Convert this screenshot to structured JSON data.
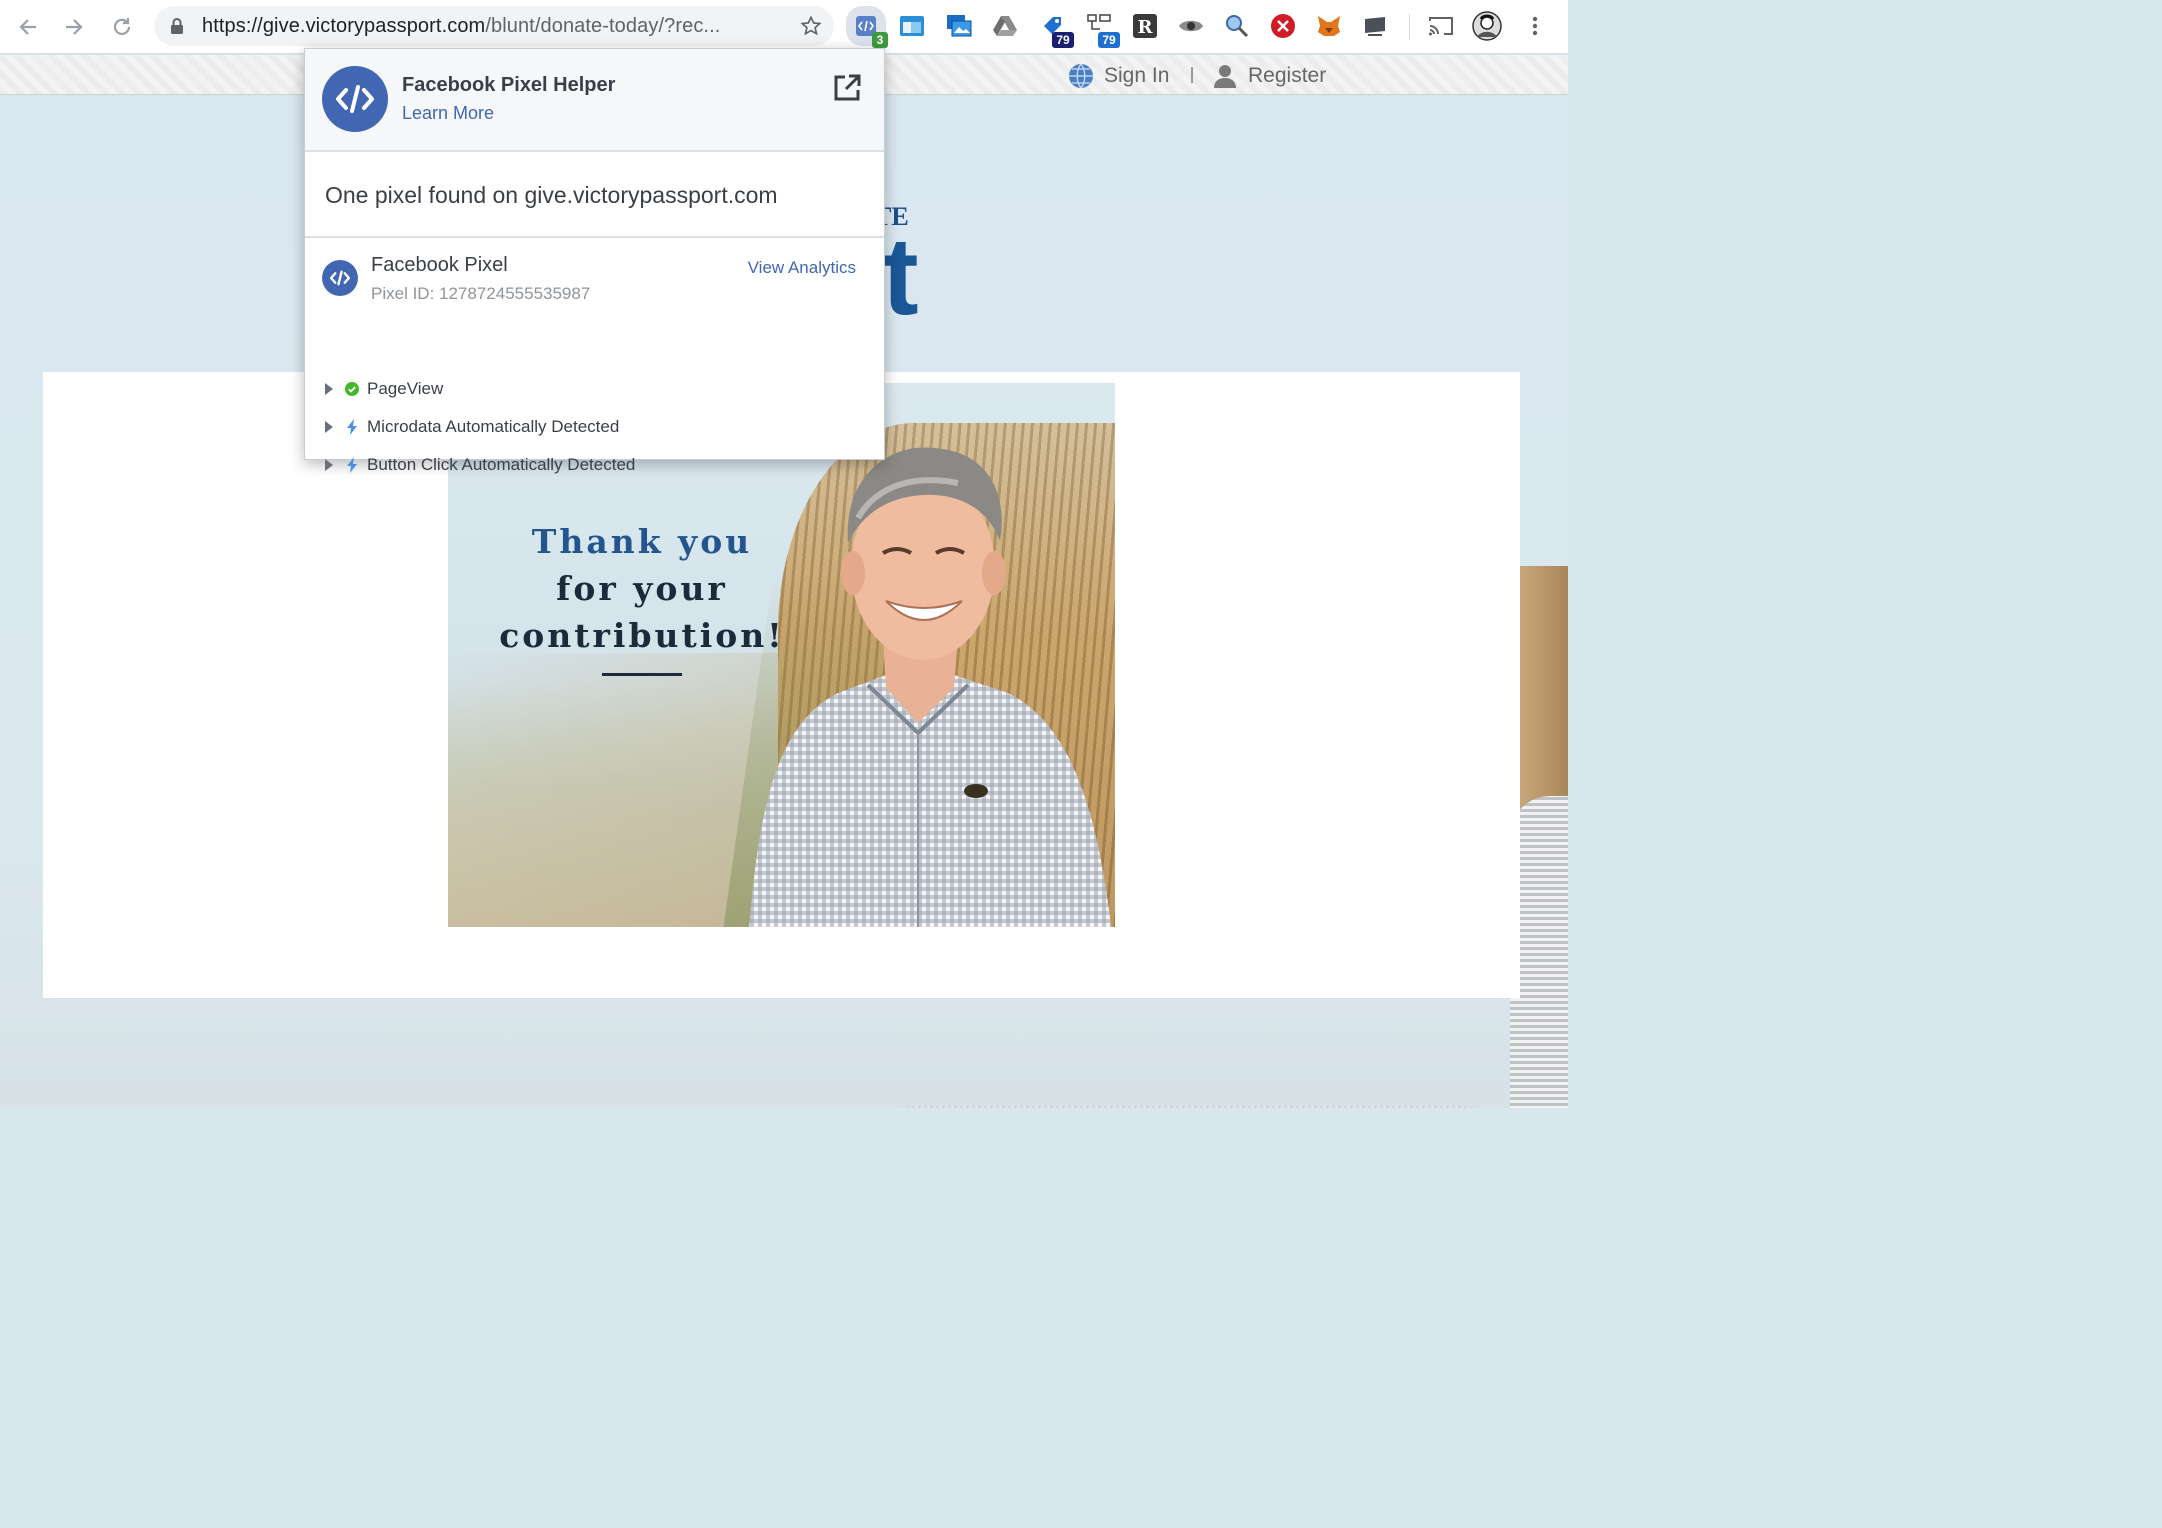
{
  "browser": {
    "url_host": "https://give.victorypassport.com",
    "url_path": "/blunt/donate-today/?rec...",
    "extensions": [
      {
        "name": "facebook-pixel-helper",
        "badge": "3",
        "badge_color": "#3f9a3f"
      },
      {
        "name": "window-capture"
      },
      {
        "name": "photo-viewer"
      },
      {
        "name": "google-drive"
      },
      {
        "name": "tag-tool",
        "badge": "79",
        "badge_color": "#1a1f71"
      },
      {
        "name": "tag-assistant",
        "badge": "79",
        "badge_color": "#1f6fd1"
      },
      {
        "name": "readability-r"
      },
      {
        "name": "eye-viewer"
      },
      {
        "name": "magnifier"
      },
      {
        "name": "blocker"
      },
      {
        "name": "metamask-fox"
      },
      {
        "name": "screen-tool"
      }
    ]
  },
  "site_header": {
    "sign_in": "Sign In",
    "register": "Register"
  },
  "background_brand": {
    "small": "TE",
    "big": "t"
  },
  "hero": {
    "line1": "Thank you",
    "line2": "for your",
    "line3": "contribution!"
  },
  "popup": {
    "title": "Facebook Pixel Helper",
    "learn_more": "Learn More",
    "summary": "One pixel found on give.victorypassport.com",
    "pixel": {
      "name": "Facebook Pixel",
      "id_text": "Pixel ID: 1278724555535987",
      "view_analytics": "View Analytics"
    },
    "events": [
      {
        "label": "PageView",
        "icon": "green-check-icon"
      },
      {
        "label": "Microdata Automatically Detected",
        "icon": "lightning-icon"
      },
      {
        "label": "Button Click Automatically Detected",
        "icon": "lightning-icon"
      }
    ]
  },
  "colors": {
    "facebook_blue": "#4267b2",
    "success_green": "#42b72a",
    "brand_blue": "#1a5796"
  }
}
